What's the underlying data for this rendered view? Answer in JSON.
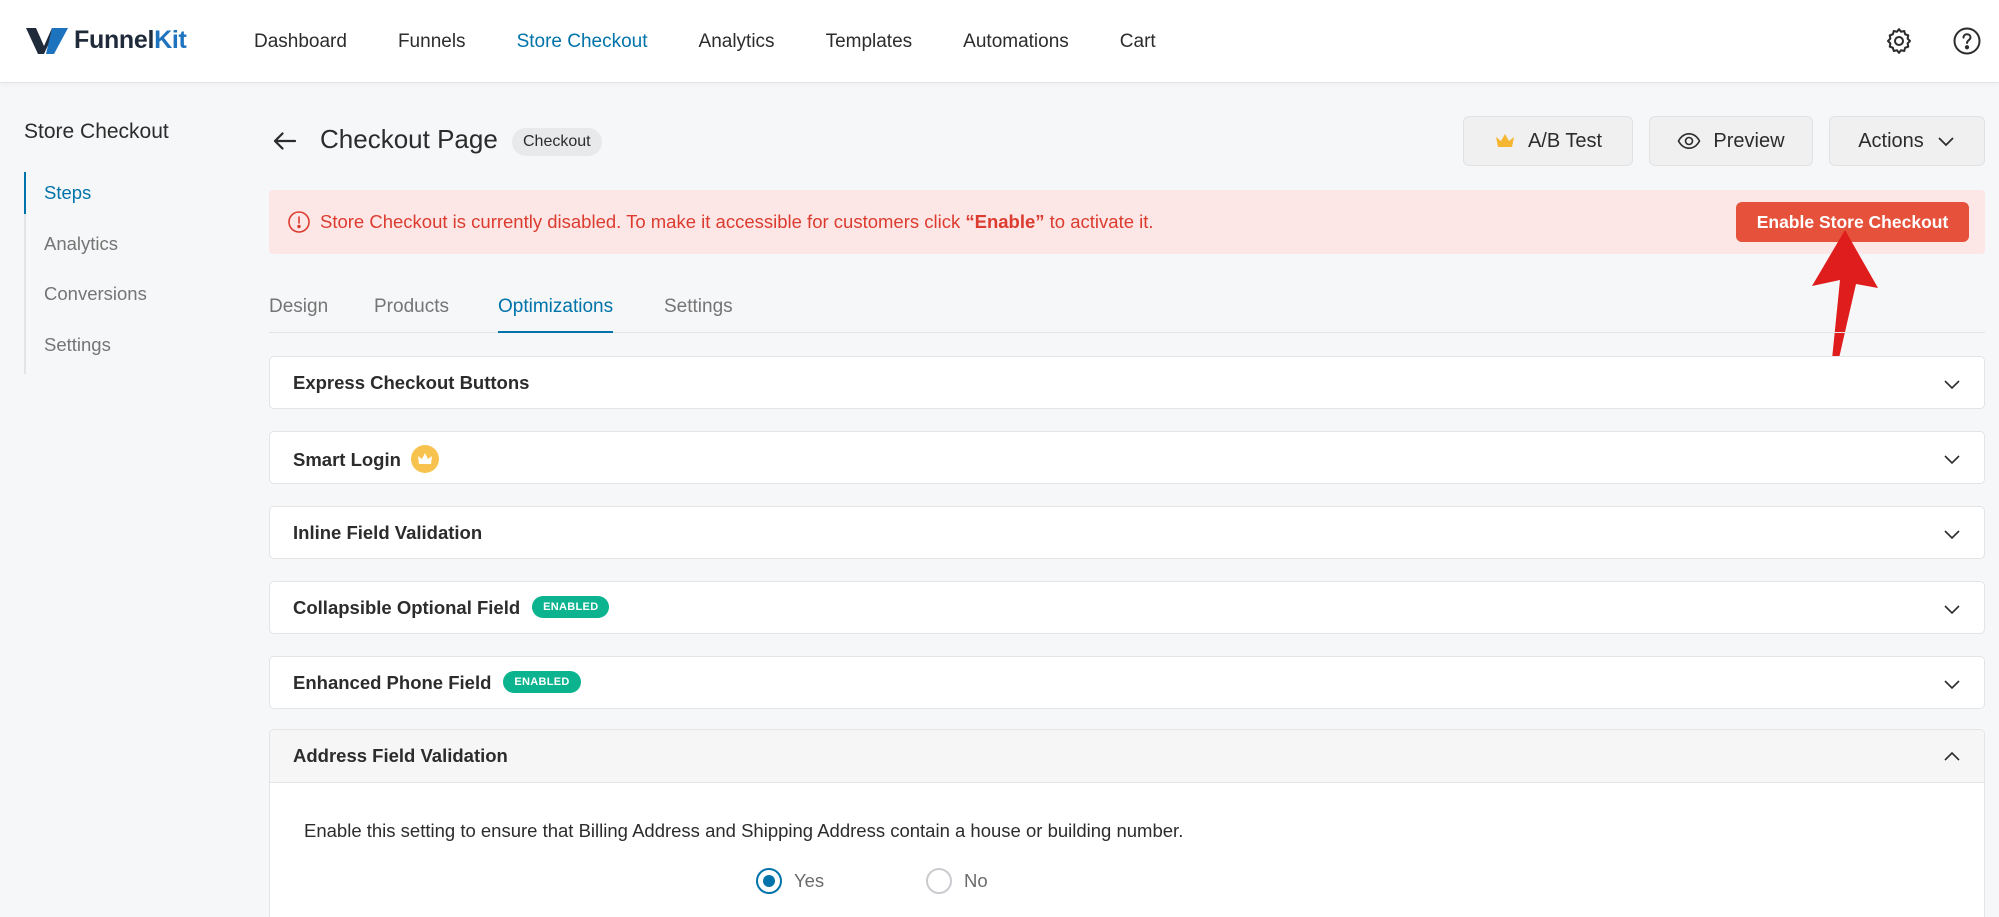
{
  "brand": {
    "name_part1": "Funnel",
    "name_part2": "Kit"
  },
  "nav": {
    "items": [
      "Dashboard",
      "Funnels",
      "Store Checkout",
      "Analytics",
      "Templates",
      "Automations",
      "Cart"
    ],
    "active": "Store Checkout"
  },
  "sidebar": {
    "title": "Store Checkout",
    "items": [
      {
        "label": "Steps",
        "active": true
      },
      {
        "label": "Analytics",
        "active": false
      },
      {
        "label": "Conversions",
        "active": false
      },
      {
        "label": "Settings",
        "active": false
      }
    ]
  },
  "header": {
    "title": "Checkout Page",
    "badge": "Checkout",
    "ab_test_label": "A/B Test",
    "preview_label": "Preview",
    "actions_label": "Actions"
  },
  "alert": {
    "text_before": "Store Checkout is currently disabled. To make it accessible for customers click ",
    "highlight": "“Enable”",
    "text_after": " to activate it.",
    "button_label": "Enable Store Checkout"
  },
  "tabs": [
    {
      "label": "Design",
      "active": false
    },
    {
      "label": "Products",
      "active": false
    },
    {
      "label": "Optimizations",
      "active": true
    },
    {
      "label": "Settings",
      "active": false
    }
  ],
  "accordions": [
    {
      "title": "Express Checkout Buttons",
      "badge": ""
    },
    {
      "title": "Smart Login",
      "badge": "crown"
    },
    {
      "title": "Inline Field Validation",
      "badge": ""
    },
    {
      "title": "Collapsible Optional Field",
      "badge": "ENABLED"
    },
    {
      "title": "Enhanced Phone Field",
      "badge": "ENABLED"
    }
  ],
  "open_accordion": {
    "title": "Address Field Validation",
    "description": "Enable this setting to ensure that Billing Address and Shipping Address contain a house or building number.",
    "options": [
      {
        "label": "Yes",
        "checked": true
      },
      {
        "label": "No",
        "checked": false
      }
    ]
  },
  "colors": {
    "accent": "#0073aa",
    "danger": "#e5513b",
    "enabled_badge": "#0bb38e",
    "crown": "#f7c34e"
  }
}
